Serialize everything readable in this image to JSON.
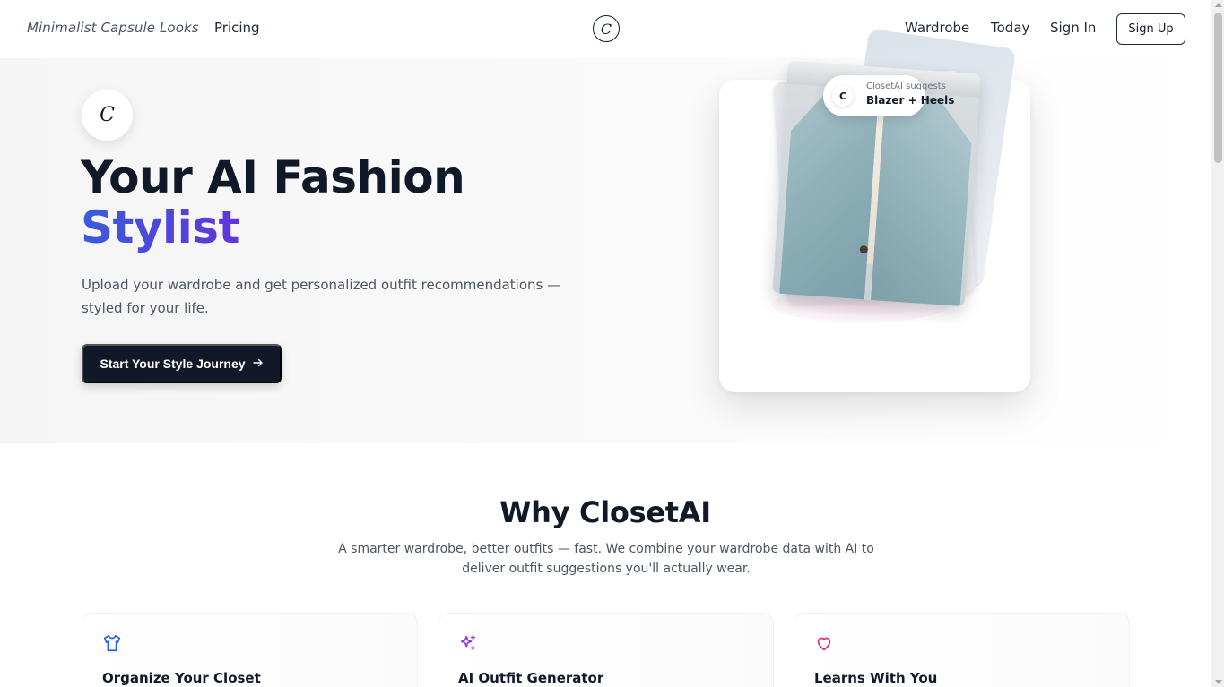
{
  "nav": {
    "brand": "Minimalist Capsule Looks",
    "pricing": "Pricing",
    "logo_letter": "C",
    "wardrobe": "Wardrobe",
    "today": "Today",
    "sign_in": "Sign In",
    "sign_up": "Sign Up"
  },
  "hero": {
    "badge_letter": "C",
    "title_line1": "Your AI Fashion",
    "title_line2": "Stylist",
    "subtitle": "Upload your wardrobe and get personalized outfit recommendations — styled for your life.",
    "cta_label": "Start Your Style Journey",
    "cta_icon": "arrow-right-icon",
    "card": {
      "pill_letter": "C",
      "pill_caption": "ClosetAI suggests",
      "pill_suggestion": "Blazer + Heels"
    }
  },
  "why": {
    "title": "Why ClosetAI",
    "subtitle": "A smarter wardrobe, better outfits — fast. We combine your wardrobe data with AI to deliver outfit suggestions you'll actually wear.",
    "features": [
      {
        "title": "Organize Your Closet",
        "icon": "shirt-icon",
        "color": "#2563eb"
      },
      {
        "title": "AI Outfit Generator",
        "icon": "sparkles-icon",
        "color": "#9333ea"
      },
      {
        "title": "Learns With You",
        "icon": "heart-icon",
        "color": "#db2777"
      }
    ]
  },
  "colors": {
    "primary_dark": "#111827",
    "accent_gradient_start": "#3b5bdb",
    "accent_gradient_end": "#a855f7"
  }
}
